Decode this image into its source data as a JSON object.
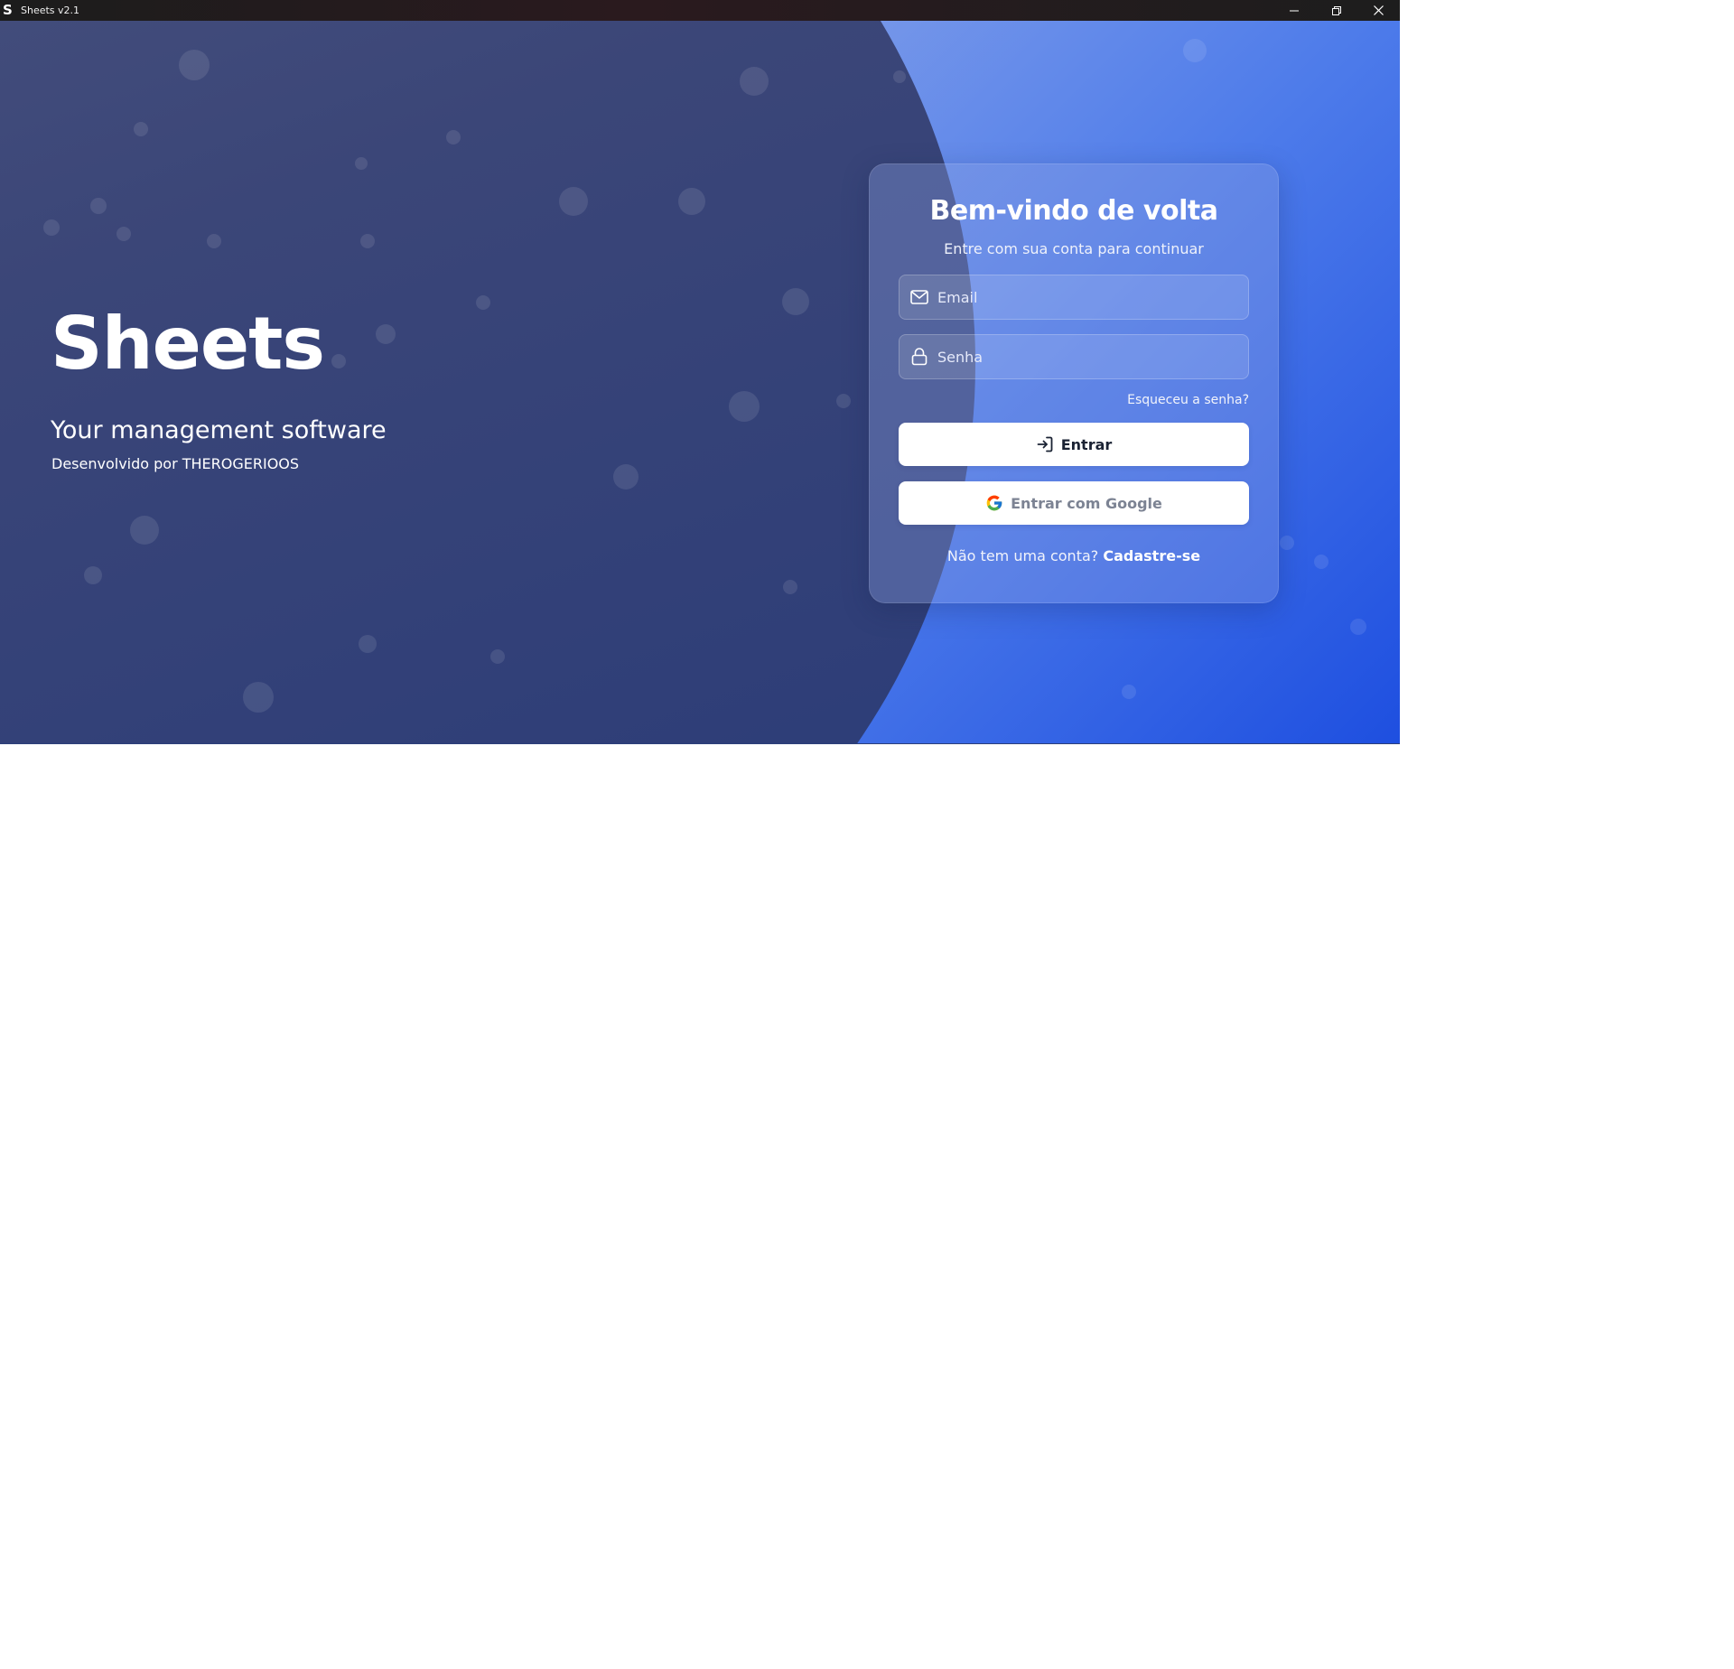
{
  "window": {
    "title": "Sheets v2.1",
    "icon_letter": "S"
  },
  "hero": {
    "title": "Sheets",
    "subtitle": "Your management software",
    "credit": "Desenvolvido por THEROGERIOOS"
  },
  "login": {
    "title": "Bem-vindo de volta",
    "subtitle": "Entre com sua conta para continuar",
    "email_placeholder": "Email",
    "password_placeholder": "Senha",
    "email_value": "",
    "password_value": "",
    "forgot_label": "Esqueceu a senha?",
    "login_button_label": "Entrar",
    "google_button_label": "Entrar com Google",
    "signup_prompt": "Não tem uma conta?",
    "signup_link_label": "Cadastre-se"
  },
  "icons": {
    "app": "app-logo-icon",
    "minimize": "minimize-icon",
    "restore": "restore-icon",
    "close": "close-icon",
    "email": "mail-icon",
    "password": "lock-icon",
    "login": "login-arrow-icon",
    "google": "google-icon"
  },
  "colors": {
    "titlebar_bg": "#1c1c1c",
    "background_dark": "#283a78",
    "background_light": "#7f9de9",
    "accent_blue": "#1e4fe0",
    "card_bg": "#8ca0e1",
    "button_bg": "#ffffff",
    "button_text": "#1a2233",
    "google_text": "#7c8393"
  }
}
